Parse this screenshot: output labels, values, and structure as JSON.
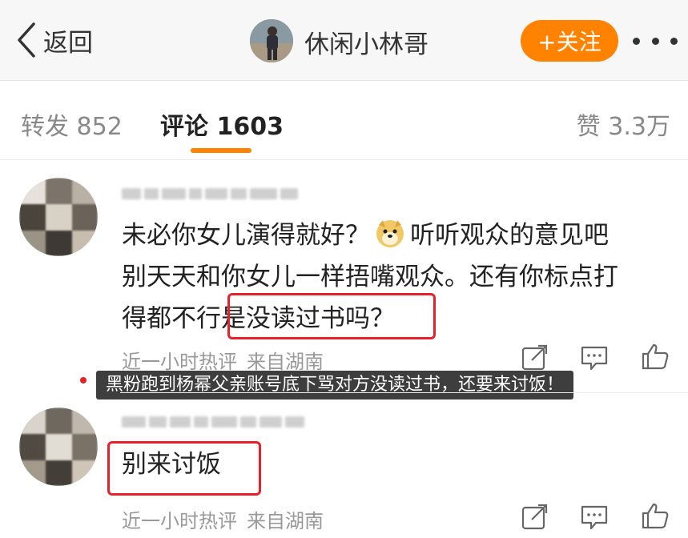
{
  "nav": {
    "back_label": "返回",
    "title": "休闲小林哥",
    "follow_label": "+关注",
    "more_icon": "more-icon"
  },
  "tabs": [
    {
      "label": "转发 852",
      "active": false
    },
    {
      "label": "评论 1603",
      "active": true
    },
    {
      "label": "赞 3.3万",
      "active": false
    }
  ],
  "colors": {
    "accent": "#ff8200",
    "highlight": "#e8202a"
  },
  "comments": [
    {
      "lines": [
        "未必你女儿演得就好？",
        "听听观众的意见吧",
        "别天天和你女儿一样捂嘴观众。还有你标点打",
        "得都不行",
        "是没读过书吗？"
      ],
      "emoji": "doge-emoji",
      "meta_time": "近一小时热评",
      "meta_source": "来自湖南"
    },
    {
      "lines": [
        "别来讨饭"
      ],
      "meta_time": "近一小时热评",
      "meta_source": "来自湖南"
    }
  ],
  "caption": "黑粉跑到杨幂父亲账号底下骂对方没读过书，还要来讨饭！"
}
